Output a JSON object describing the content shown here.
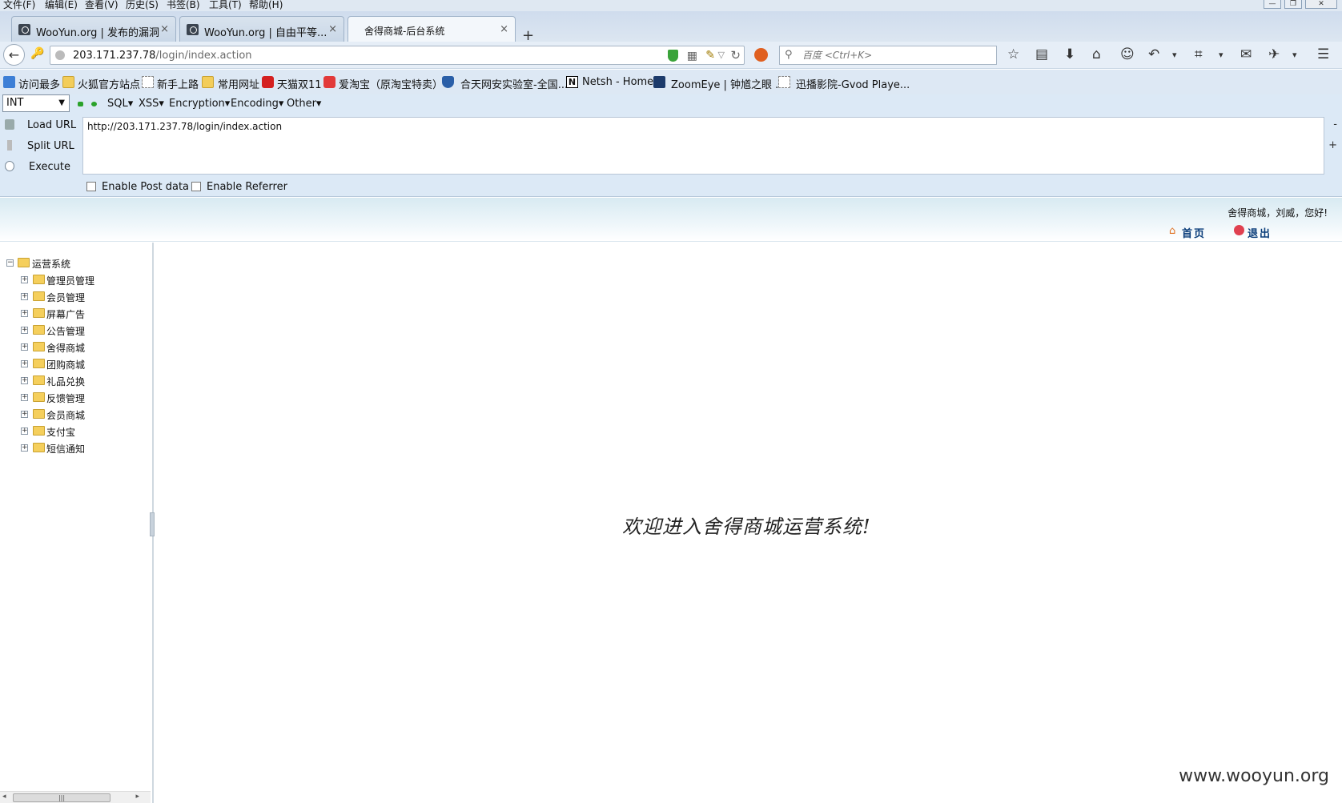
{
  "menu": [
    "文件(F)",
    "编辑(E)",
    "查看(V)",
    "历史(S)",
    "书签(B)",
    "工具(T)",
    "帮助(H)"
  ],
  "window_controls": {
    "minimize": "—",
    "restore": "❐",
    "close": "✕"
  },
  "tabs": [
    {
      "label": "WooYun.org | 发布的漏洞",
      "close": "×"
    },
    {
      "label": "WooYun.org | 自由平等...",
      "close": "×"
    },
    {
      "label": "舍得商城-后台系统",
      "close": "×",
      "active": true
    }
  ],
  "new_tab": "+",
  "nav": {
    "back": "←",
    "url_host": "203.171.237.78",
    "url_path": "/login/index.action",
    "search_placeholder": "百度 <Ctrl+K>",
    "icons": [
      "star-icon",
      "reading-list-icon",
      "download-icon",
      "home-icon",
      "chat-icon",
      "undo-icon",
      "crop-icon",
      "comment-icon",
      "extension-icon",
      "menu-icon"
    ]
  },
  "bookmarks": [
    "访问最多",
    "火狐官方站点",
    "新手上路",
    "常用网址",
    "天猫双11",
    "爱淘宝（原淘宝特卖）",
    "合天网安实验室-全国...",
    "Netsh - Home",
    "ZoomEye | 钟馗之眼 ...",
    "迅播影院-Gvod Playe..."
  ],
  "hackbar": {
    "type_select": "INT",
    "menus": [
      "SQL",
      "XSS",
      "Encryption",
      "Encoding",
      "Other"
    ],
    "buttons": [
      "Load URL",
      "Split URL",
      "Execute"
    ],
    "url_text": "http://203.171.237.78/login/index.action",
    "side_minus": "-",
    "side_plus": "+",
    "checkboxes": [
      "Enable Post data",
      "Enable Referrer"
    ]
  },
  "admin": {
    "greeting": "舍得商城，刘威，您好!",
    "home_link": "首页",
    "logout_link": "退出",
    "tree_root": "运营系统",
    "tree_items": [
      "管理员管理",
      "会员管理",
      "屏幕广告",
      "公告管理",
      "舍得商城",
      "团购商城",
      "礼品兑换",
      "反馈管理",
      "会员商城",
      "支付宝",
      "短信通知"
    ],
    "welcome": "欢迎进入舍得商城运营系统!"
  },
  "watermark": "www.wooyun.org",
  "colors": {
    "accent_link": "#0a3d7a",
    "folder": "#f5cf5c",
    "shield": "#3aa33a"
  }
}
